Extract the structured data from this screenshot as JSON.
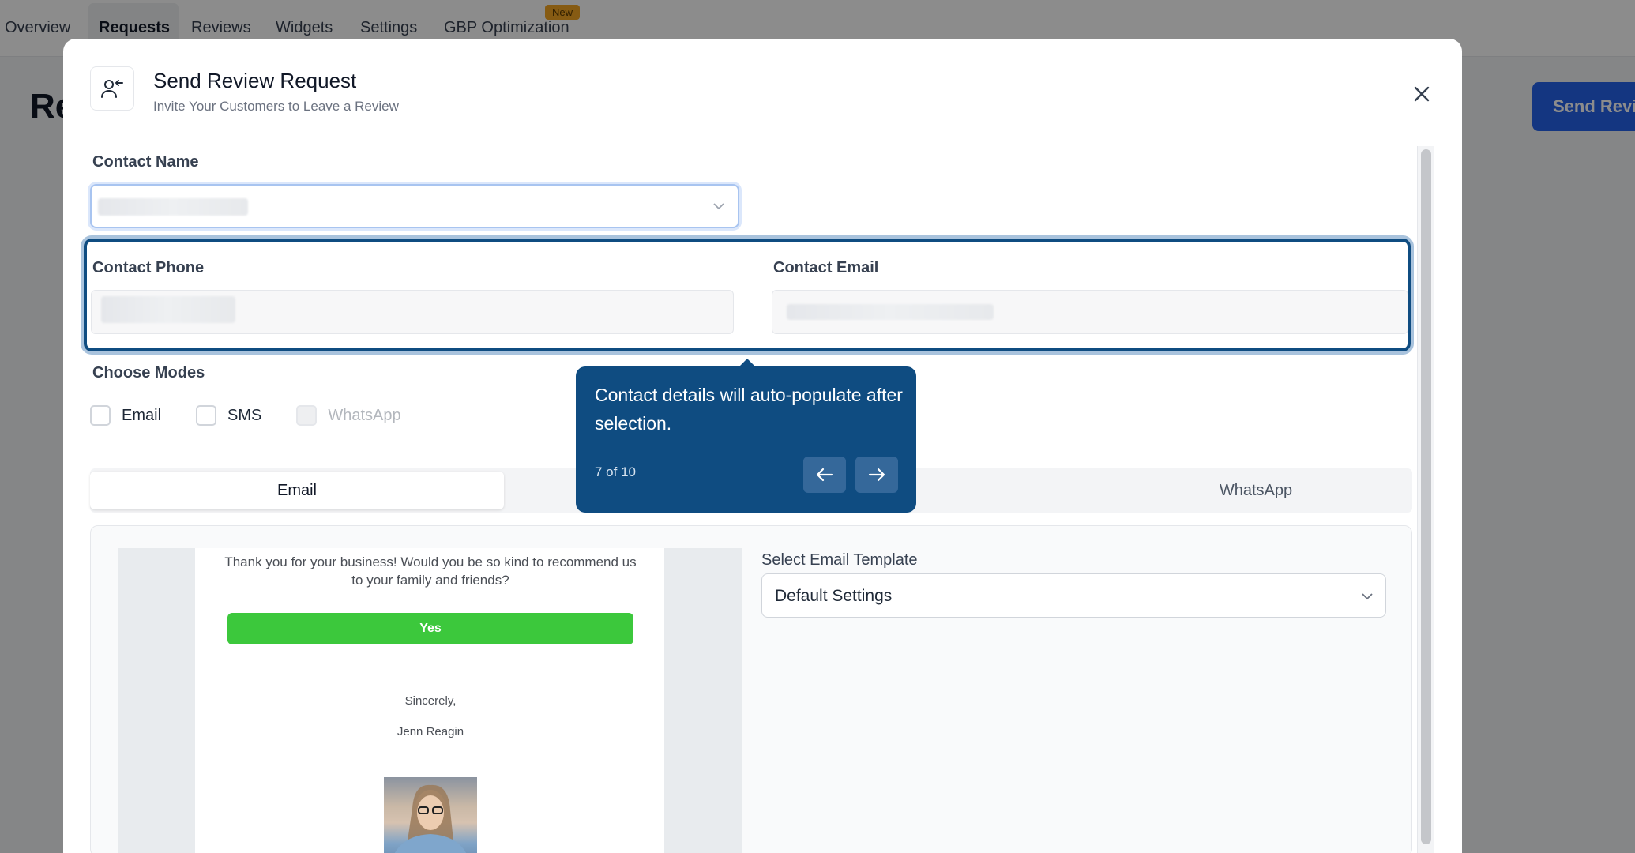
{
  "background": {
    "tabs": [
      "Overview",
      "Requests",
      "Reviews",
      "Widgets",
      "Settings",
      "GBP Optimization"
    ],
    "active_tab": "Requests",
    "new_badge": "New",
    "heading": "Re",
    "send_button": "Send Revi"
  },
  "modal": {
    "icon": "user-add-icon",
    "title": "Send Review Request",
    "subtitle": "Invite Your Customers to Leave a Review",
    "close_icon": "close-icon",
    "contact_name_label": "Contact Name",
    "contact_phone_label": "Contact Phone",
    "contact_email_label": "Contact Email",
    "choose_modes_label": "Choose Modes",
    "modes": [
      {
        "label": "Email",
        "checked": false,
        "disabled": false
      },
      {
        "label": "SMS",
        "checked": false,
        "disabled": false
      },
      {
        "label": "WhatsApp",
        "checked": false,
        "disabled": true
      }
    ],
    "tabs": {
      "email": "Email",
      "whatsapp": "WhatsApp"
    },
    "preview": {
      "message": "Thank you for your business! Would you be so kind to recommend us to your family and friends?",
      "yes_button": "Yes",
      "closing": "Sincerely,",
      "signature": "Jenn Reagin"
    },
    "template": {
      "label": "Select Email Template",
      "value": "Default Settings"
    }
  },
  "tooltip": {
    "text": "Contact details will auto-populate after selection.",
    "step": "7 of 10",
    "prev_icon": "arrow-left-icon",
    "next_icon": "arrow-right-icon"
  },
  "colors": {
    "tooltip_bg": "#0f4c81",
    "primary": "#2563eb",
    "yes_green": "#3cc83c"
  }
}
